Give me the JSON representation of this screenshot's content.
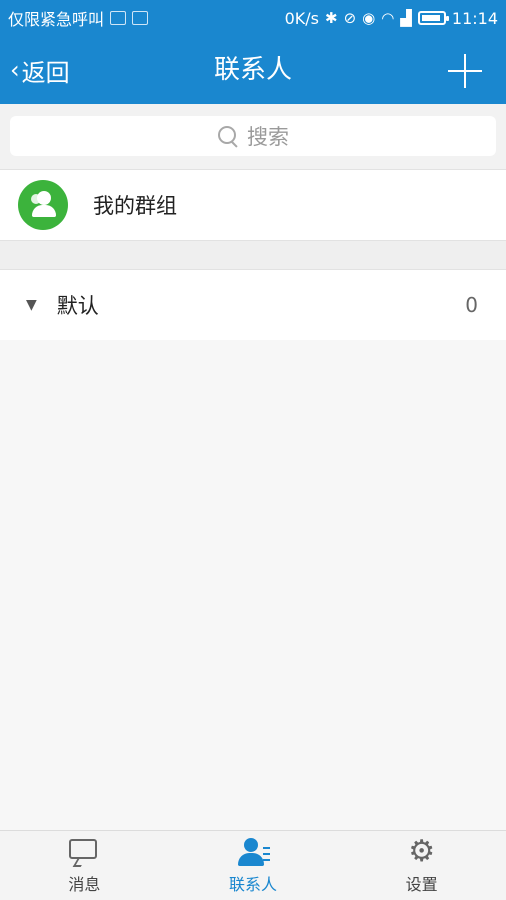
{
  "status_bar": {
    "carrier": "仅限紧急呼叫",
    "speed": "0K/s",
    "time": "11:14",
    "icons": [
      "gallery-icon",
      "image-icon",
      "bluetooth-icon",
      "mute-icon",
      "eye-icon",
      "wifi-icon",
      "signal-icon",
      "battery-icon"
    ]
  },
  "nav": {
    "back_label": "返回",
    "title": "联系人",
    "add_icon": "plus-icon"
  },
  "search": {
    "placeholder": "搜索"
  },
  "group": {
    "label": "我的群组"
  },
  "default_group": {
    "label": "默认",
    "count": "0"
  },
  "tabs": [
    {
      "label": "消息",
      "icon": "message-icon",
      "active": false
    },
    {
      "label": "联系人",
      "icon": "contacts-icon",
      "active": true
    },
    {
      "label": "设置",
      "icon": "gear-icon",
      "active": false
    }
  ],
  "colors": {
    "primary": "#1a87cf",
    "group_avatar": "#3cb33c",
    "background": "#f7f7f7"
  }
}
